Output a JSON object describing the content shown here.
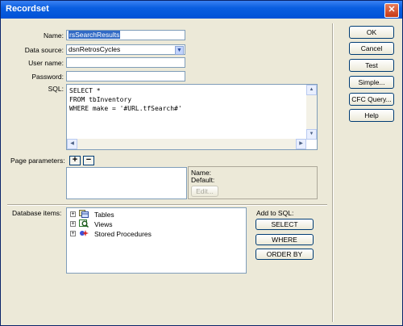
{
  "window": {
    "title": "Recordset"
  },
  "form": {
    "name_label": "Name:",
    "name_value": "rsSearchResults",
    "datasource_label": "Data source:",
    "datasource_value": "dsnRetrosCycles",
    "username_label": "User name:",
    "username_value": "",
    "password_label": "Password:",
    "password_value": "",
    "sql_label": "SQL:",
    "sql_lines": [
      "SELECT *",
      "FROM tbInventory",
      "WHERE make = '#URL.tfSearch#'"
    ]
  },
  "params": {
    "label": "Page parameters:",
    "add_label": "+",
    "remove_label": "−",
    "name_label": "Name:",
    "default_label": "Default:",
    "edit_label": "Edit..."
  },
  "db": {
    "label": "Database items:",
    "items": [
      {
        "label": "Tables",
        "icon": "tables-icon"
      },
      {
        "label": "Views",
        "icon": "views-icon"
      },
      {
        "label": "Stored Procedures",
        "icon": "stored-procedures-icon"
      }
    ],
    "add_to_sql_label": "Add to SQL:",
    "select_label": "SELECT",
    "where_label": "WHERE",
    "orderby_label": "ORDER BY"
  },
  "buttons": {
    "ok": "OK",
    "cancel": "Cancel",
    "test": "Test",
    "simple": "Simple...",
    "cfc_query": "CFC Query...",
    "help": "Help"
  },
  "colors": {
    "titlebar": "#0a5ee0",
    "dialog": "#ece9d8",
    "selection": "#316ac5"
  }
}
